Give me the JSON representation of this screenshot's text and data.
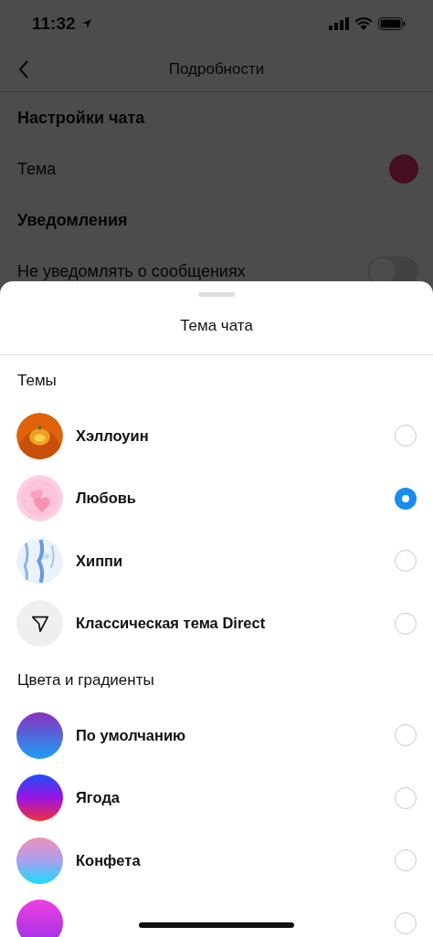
{
  "status_bar": {
    "time": "11:32"
  },
  "nav": {
    "title": "Подробности"
  },
  "background": {
    "sections": [
      {
        "title": "Настройки чата",
        "rows": [
          {
            "kind": "swatch",
            "label": "Тема"
          }
        ]
      },
      {
        "title": "Уведомления",
        "rows": [
          {
            "kind": "toggle",
            "label": "Не уведомлять о сообщениях",
            "on": false
          }
        ]
      }
    ]
  },
  "sheet": {
    "title": "Тема чата",
    "groups": [
      {
        "title": "Темы",
        "items": [
          {
            "kind": "picture",
            "label": "Хэллоуин",
            "selected": false
          },
          {
            "kind": "picture",
            "label": "Любовь",
            "selected": true
          },
          {
            "kind": "picture",
            "label": "Хиппи",
            "selected": false
          },
          {
            "kind": "icon",
            "label": "Классическая тема Direct",
            "selected": false
          }
        ]
      },
      {
        "title": "Цвета и градиенты",
        "items": [
          {
            "kind": "gradient",
            "label": "По умолчанию",
            "selected": false
          },
          {
            "kind": "gradient",
            "label": "Ягода",
            "selected": false
          },
          {
            "kind": "gradient",
            "label": "Конфета",
            "selected": false
          },
          {
            "kind": "gradient",
            "selected": false
          }
        ]
      }
    ]
  }
}
